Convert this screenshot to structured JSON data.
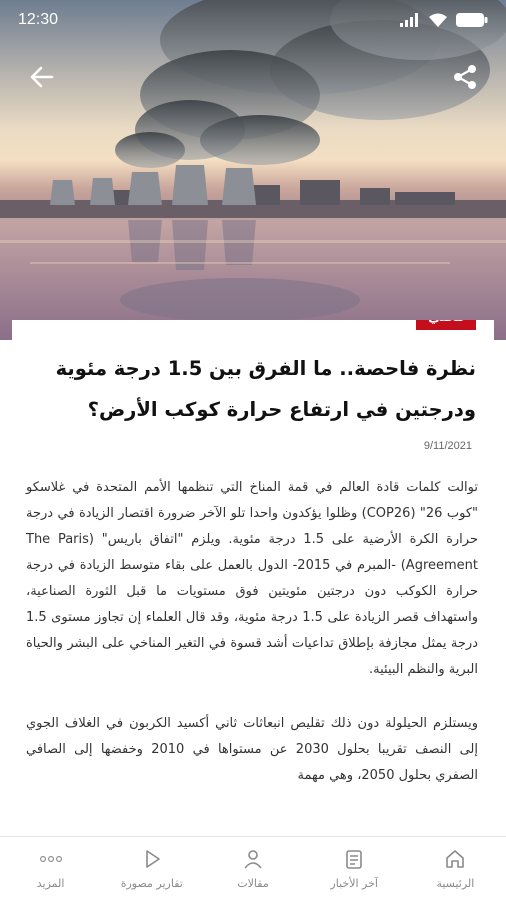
{
  "status_bar": {
    "time": "12:30"
  },
  "article": {
    "category": "محلي",
    "title": "نظرة فاحصة.. ما الفرق بين 1.5 درجة مئوية ودرجتين في ارتفاع حرارة كوكب الأرض؟",
    "date": "9/11/2021",
    "paragraphs": [
      "توالت كلمات قادة العالم في قمة المناخ التي تنظمها الأمم المتحدة في غلاسكو \"كوب 26\" (COP26) وظلوا يؤكدون واحدا تلو الآخر ضرورة اقتصار الزيادة في درجة حرارة الكرة الأرضية على 1.5 درجة مئوية. ويلزم \"اتفاق باريس\" (The Paris Agreement) -المبرم في 2015- الدول بالعمل على بقاء متوسط الزيادة في درجة حرارة الكوكب دون درجتين مئويتين فوق مستويات ما قبل الثورة الصناعية، واستهداف قصر الزيادة على 1.5 درجة مئوية، وقد قال العلماء إن تجاوز مستوى 1.5 درجة يمثل مجازفة بإطلاق تداعيات أشد قسوة في التغير المناخي على البشر والحياة البرية والنظم البيئية.",
      "ويستلزم الحيلولة دون ذلك تقليص انبعاثات ثاني أكسيد الكربون في الغلاف الجوي إلى النصف تقريبا بحلول 2030 عن مستواها في 2010 وخفضها إلى الصافي الصفري بحلول 2050، وهي مهمة"
    ]
  },
  "bottom_nav": {
    "items": [
      {
        "label": "الرئيسية",
        "icon": "home-icon"
      },
      {
        "label": "آخر الأخبار",
        "icon": "news-icon"
      },
      {
        "label": "مقالات",
        "icon": "person-icon"
      },
      {
        "label": "تقارير مصورة",
        "icon": "play-icon"
      },
      {
        "label": "المزيد",
        "icon": "more-icon"
      }
    ]
  }
}
